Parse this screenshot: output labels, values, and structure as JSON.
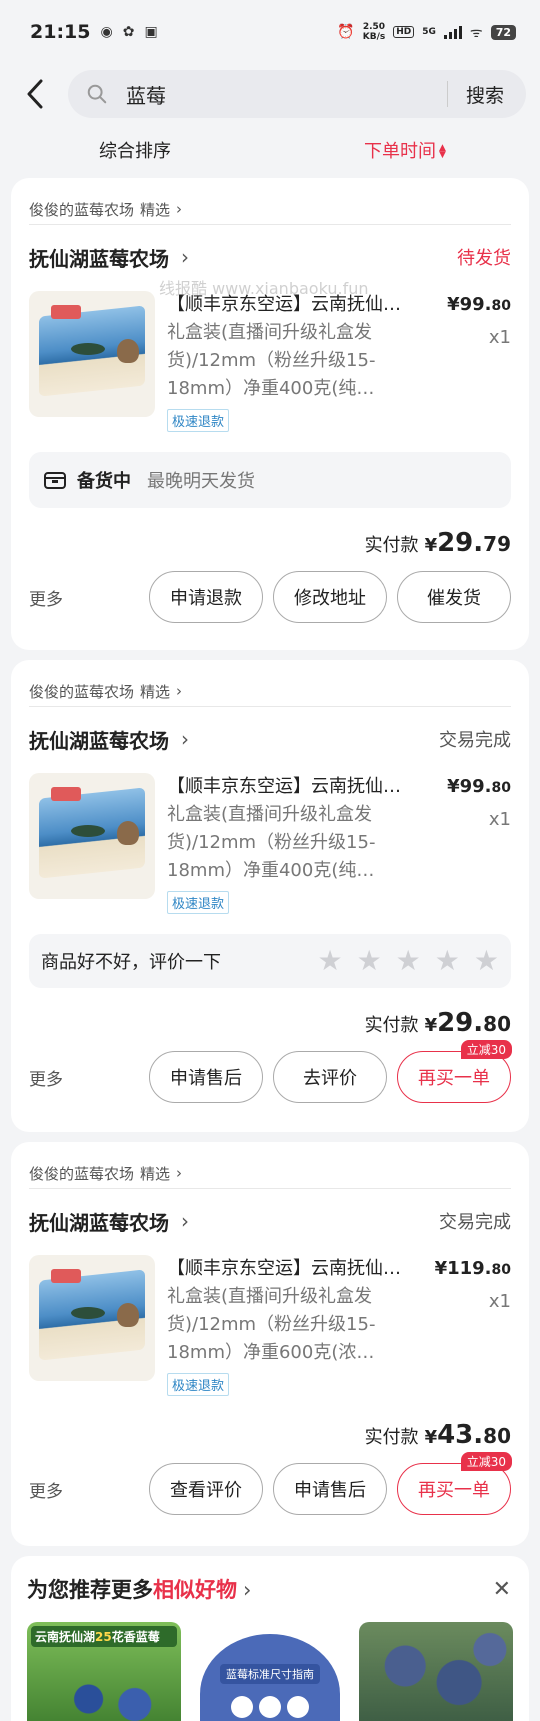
{
  "status_bar": {
    "time": "21:15",
    "net_speed_value": "2.50",
    "net_speed_unit": "KB/s",
    "hd": "HD",
    "network": "5G",
    "battery": "72"
  },
  "search": {
    "query": "蓝莓",
    "button": "搜索"
  },
  "sort": {
    "items": [
      "综合排序",
      "下单时间"
    ]
  },
  "orders": [
    {
      "store_label": "俊俊的蓝莓农场",
      "selected_label": "精选",
      "shop_name": "抚仙湖蓝莓农场",
      "status": "待发货",
      "title": "【顺丰京东空运】云南抚仙湖蓝莓",
      "desc": "礼盒装(直播间升级礼盒发货)/12mm（粉丝升级15-18mm）净重400克(纯…",
      "price_int": "¥99.",
      "price_dec": "80",
      "qty": "x1",
      "tag": "极速退款",
      "notice_bold": "备货中",
      "notice_text": "最晚明天发货",
      "paid_label": "实付款",
      "paid_cur": "¥",
      "paid_int": "29.",
      "paid_dec": "79",
      "more": "更多",
      "buttons": [
        "申请退款",
        "修改地址",
        "催发货"
      ],
      "watermark": "线报酷 www.xianbaoku.fun"
    },
    {
      "store_label": "俊俊的蓝莓农场",
      "selected_label": "精选",
      "shop_name": "抚仙湖蓝莓农场",
      "status": "交易完成",
      "title": "【顺丰京东空运】云南抚仙湖蓝莓",
      "desc": "礼盒装(直播间升级礼盒发货)/12mm（粉丝升级15-18mm）净重400克(纯…",
      "price_int": "¥99.",
      "price_dec": "80",
      "qty": "x1",
      "tag": "极速退款",
      "review_text": "商品好不好，评价一下",
      "stars": 5,
      "paid_label": "实付款",
      "paid_cur": "¥",
      "paid_int": "29.",
      "paid_dec": "80",
      "more": "更多",
      "buttons": [
        "申请售后",
        "去评价",
        "再买一单"
      ],
      "badge": "立减30"
    },
    {
      "store_label": "俊俊的蓝莓农场",
      "selected_label": "精选",
      "shop_name": "抚仙湖蓝莓农场",
      "status": "交易完成",
      "title": "【顺丰京东空运】云南抚仙湖蓝莓",
      "desc": "礼盒装(直播间升级礼盒发货)/12mm（粉丝升级15-18mm）净重600克(浓…",
      "price_int": "¥119.",
      "price_dec": "80",
      "qty": "x1",
      "tag": "极速退款",
      "paid_label": "实付款",
      "paid_cur": "¥",
      "paid_int": "43.",
      "paid_dec": "80",
      "more": "更多",
      "buttons": [
        "查看评价",
        "申请售后",
        "再买一单"
      ],
      "badge": "立减30"
    }
  ],
  "recommend": {
    "title_prefix": "为您推荐更多",
    "title_highlight": "相似好物",
    "img1_label": "云南抚仙湖",
    "img1_label_num": "25",
    "img1_label_suffix": "花香蓝莓",
    "img2_label": "蓝莓标准尺寸指南"
  },
  "colors": {
    "accent": "#e8314a",
    "tag_blue": "#2f86c5",
    "background": "#f3f4f6"
  }
}
